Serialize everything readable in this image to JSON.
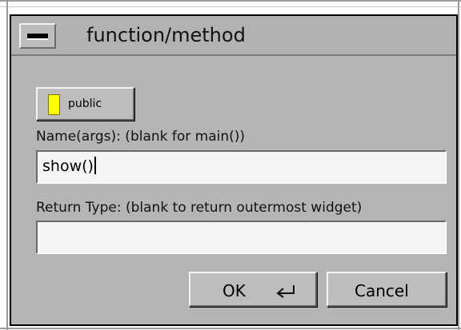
{
  "window": {
    "title": "function/method"
  },
  "public_button": {
    "label": "public",
    "indicator_color": "#ffff00"
  },
  "name_field": {
    "label": "Name(args): (blank for main())",
    "value": "show()"
  },
  "return_field": {
    "label": "Return Type: (blank to return outermost widget)",
    "value": ""
  },
  "buttons": {
    "ok_label": "OK",
    "cancel_label": "Cancel"
  },
  "icons": {
    "window_menu": "window-menu-icon",
    "return_key": "return-key-icon"
  }
}
